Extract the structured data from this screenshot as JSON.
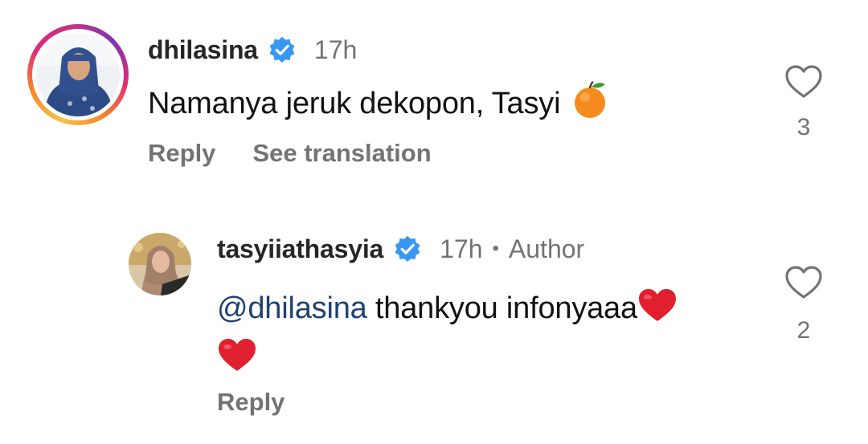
{
  "comments": [
    {
      "username": "dhilasina",
      "time": "17h",
      "text": "Namanya jeruk dekopon, Tasyi",
      "emoji": "orange-emoji",
      "actions": {
        "reply": "Reply",
        "translate": "See translation"
      },
      "likes": "3"
    },
    {
      "username": "tasyiiathasyia",
      "time": "17h",
      "separator": "•",
      "badge": "Author",
      "mention": "@dhilasina",
      "text": " thankyou infonyaaa",
      "emoji": "red-heart-emoji",
      "actions": {
        "reply": "Reply"
      },
      "likes": "2"
    }
  ],
  "colors": {
    "verified": "#3897f0",
    "mention": "#1e4270",
    "muted": "#737373",
    "heart": "#e0202e"
  }
}
